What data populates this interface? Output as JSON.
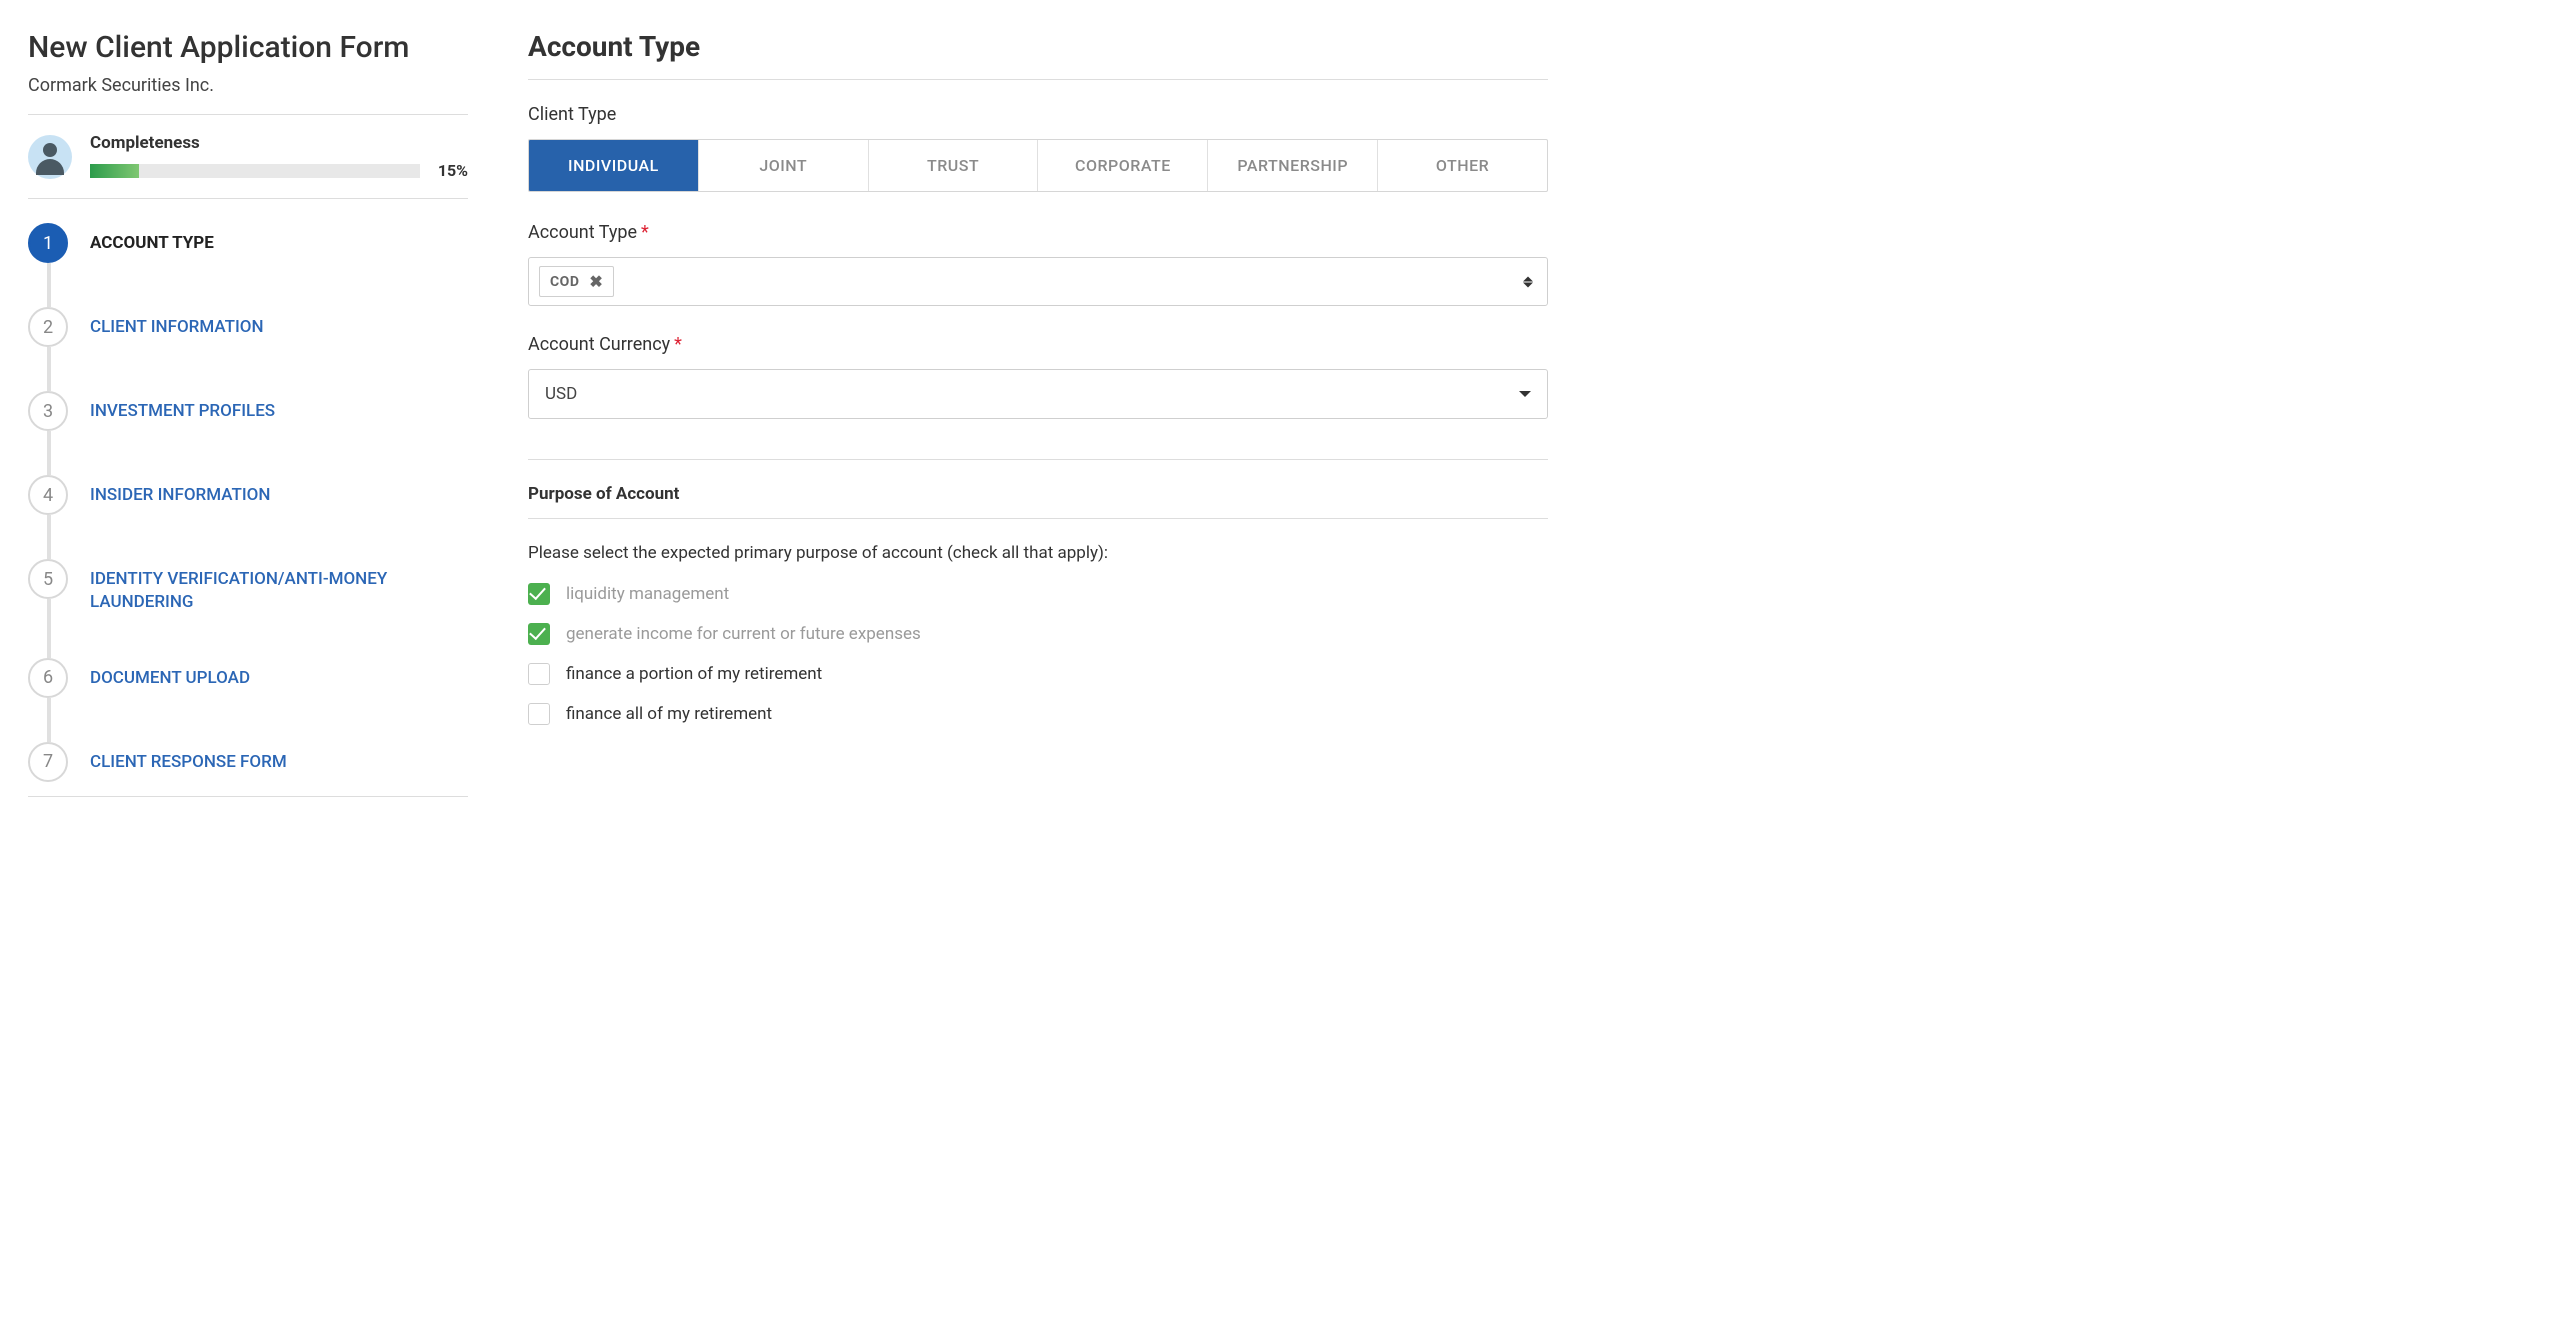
{
  "sidebar": {
    "title": "New Client Application Form",
    "company": "Cormark Securities Inc.",
    "completeness_label": "Completeness",
    "completeness_pct": "15%",
    "steps": [
      {
        "num": "1",
        "label": "ACCOUNT TYPE",
        "active": true
      },
      {
        "num": "2",
        "label": "CLIENT INFORMATION",
        "active": false
      },
      {
        "num": "3",
        "label": "INVESTMENT PROFILES",
        "active": false
      },
      {
        "num": "4",
        "label": "INSIDER INFORMATION",
        "active": false
      },
      {
        "num": "5",
        "label": "IDENTITY VERIFICATION/ANTI-MONEY LAUNDERING",
        "active": false
      },
      {
        "num": "6",
        "label": "DOCUMENT UPLOAD",
        "active": false
      },
      {
        "num": "7",
        "label": "CLIENT RESPONSE FORM",
        "active": false
      }
    ]
  },
  "main": {
    "section_title": "Account Type",
    "client_type_label": "Client Type",
    "client_types": [
      {
        "label": "INDIVIDUAL",
        "active": true
      },
      {
        "label": "JOINT",
        "active": false
      },
      {
        "label": "TRUST",
        "active": false
      },
      {
        "label": "CORPORATE",
        "active": false
      },
      {
        "label": "PARTNERSHIP",
        "active": false
      },
      {
        "label": "OTHER",
        "active": false
      }
    ],
    "account_type_label": "Account Type",
    "account_type_tags": [
      "COD"
    ],
    "account_currency_label": "Account Currency",
    "account_currency_value": "USD",
    "purpose_title": "Purpose of Account",
    "purpose_prompt": "Please select the expected primary purpose of account (check all that apply):",
    "purpose_options": [
      {
        "label": "liquidity management",
        "checked": true
      },
      {
        "label": "generate income for current or future expenses",
        "checked": true
      },
      {
        "label": "finance a portion of my retirement",
        "checked": false
      },
      {
        "label": "finance all of my retirement",
        "checked": false
      }
    ]
  }
}
